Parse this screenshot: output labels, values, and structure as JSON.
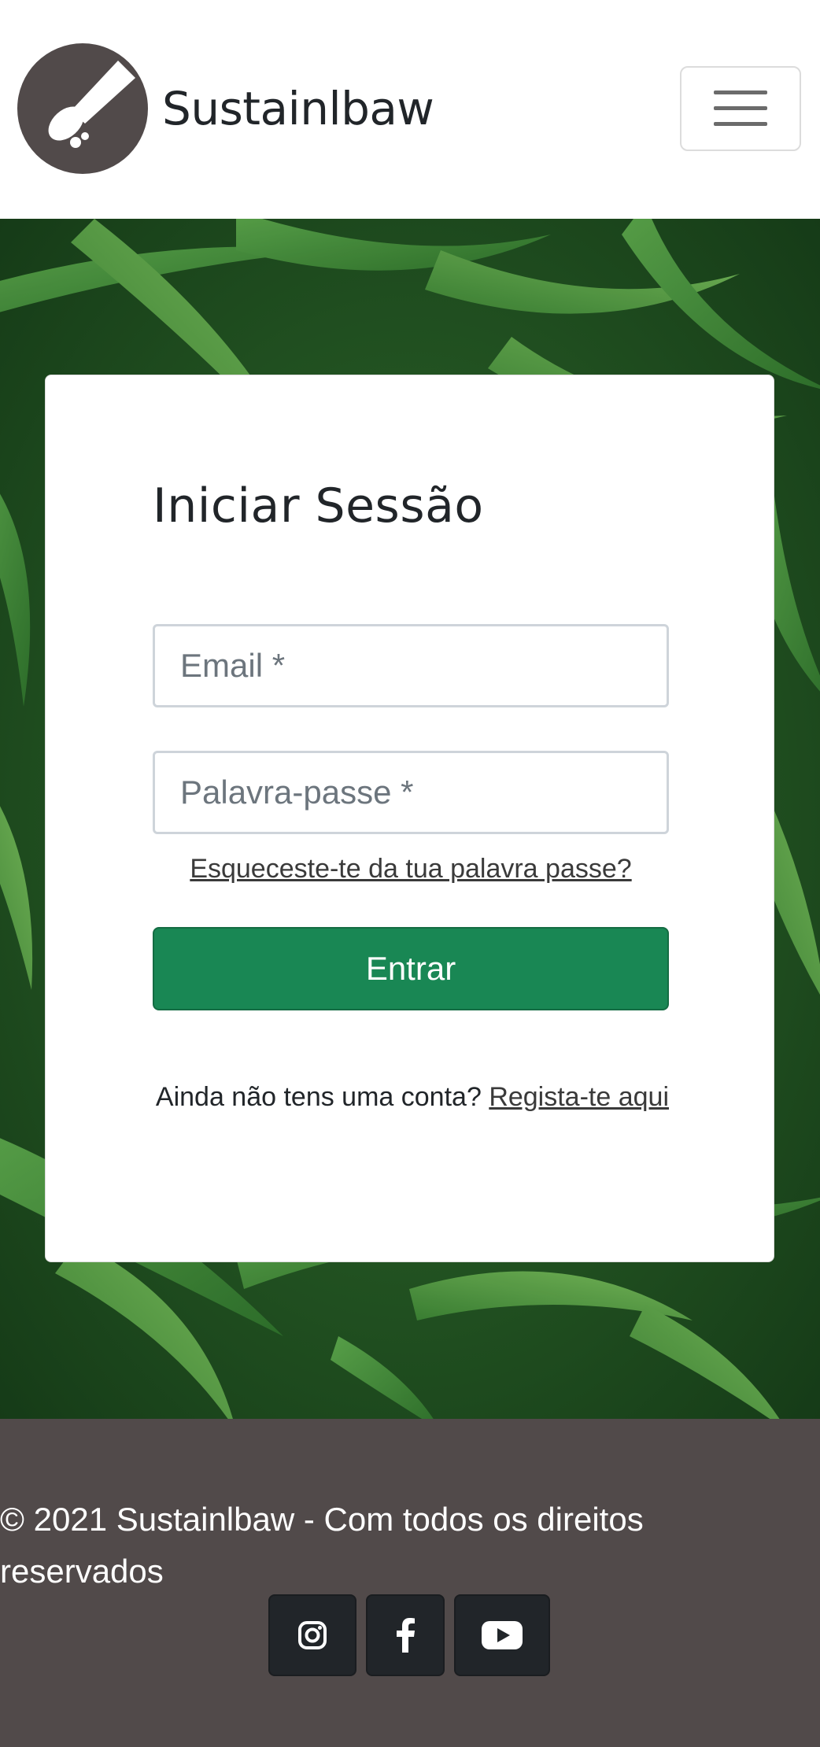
{
  "header": {
    "brand_name": "Sustainlbaw",
    "logo_icon": "brush-logo-icon",
    "menu_icon": "hamburger-menu-icon",
    "logo_color": "#514a4a"
  },
  "login": {
    "title": "Iniciar Sessão",
    "email_placeholder": "Email *",
    "email_value": "",
    "password_placeholder": "Palavra-passe *",
    "password_value": "",
    "forgot_link": "Esqueceste-te da tua palavra passe?",
    "submit_label": "Entrar",
    "register_prompt": "Ainda não tens uma conta?",
    "register_link": "Regista-te aqui",
    "submit_color": "#198754"
  },
  "footer": {
    "copyright": "© 2021 Sustainlbaw - Com todos os direitos reservados",
    "background_color": "#514a4a",
    "socials": [
      {
        "name": "Instagram",
        "icon": "instagram-icon"
      },
      {
        "name": "Facebook",
        "icon": "facebook-icon"
      },
      {
        "name": "YouTube",
        "icon": "youtube-icon"
      }
    ]
  }
}
